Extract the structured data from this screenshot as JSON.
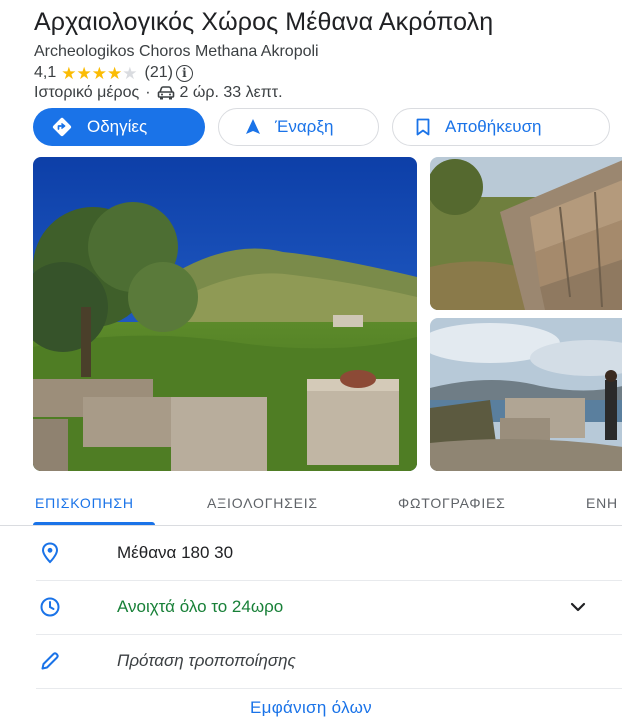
{
  "place": {
    "title": "Αρχαιολογικός Χώρος Μέθανα Ακρόπολη",
    "subtitle": "Archeologikos Choros Methana Akropoli",
    "rating": "4,1",
    "rating_value": 4.1,
    "stars_max": 5,
    "review_count": "(21)",
    "category": "Ιστορικό μέρος",
    "separator": "·",
    "drive_time": "2 ώρ. 33 λεπτ.",
    "icons": {
      "info": "info-icon",
      "drive": "car-icon"
    },
    "colors": {
      "star": "#fbbc04",
      "star_empty": "#dadce0"
    }
  },
  "actions": {
    "directions_label": "Οδηγίες",
    "start_label": "Έναρξη",
    "save_label": "Αποθήκευση",
    "icons": {
      "directions": "directions-icon",
      "start": "navigation-arrow-icon",
      "save": "bookmark-icon"
    },
    "colors": {
      "primary": "#1a73e8"
    }
  },
  "tabs": [
    {
      "label": "ΕΠΙΣΚΟΠΗΣΗ",
      "active": true
    },
    {
      "label": "ΑΞΙΟΛΟΓΗΣΕΙΣ",
      "active": false
    },
    {
      "label": "ΦΩΤΟΓΡΑΦΙΕΣ",
      "active": false
    },
    {
      "label": "ΕΝΗ",
      "active": false
    }
  ],
  "details": {
    "address": "Μέθανα 180 30",
    "hours": "Ανοιχτά όλο το 24ωρο",
    "suggest_edit": "Πρόταση τροποποίησης",
    "icons": {
      "address": "location-pin-icon",
      "hours": "clock-icon",
      "hours_toggle": "chevron-down-icon",
      "suggest": "pencil-icon"
    },
    "colors": {
      "open": "#188038",
      "icon": "#1a73e8"
    }
  },
  "show_all_label": "Εμφάνιση όλων"
}
